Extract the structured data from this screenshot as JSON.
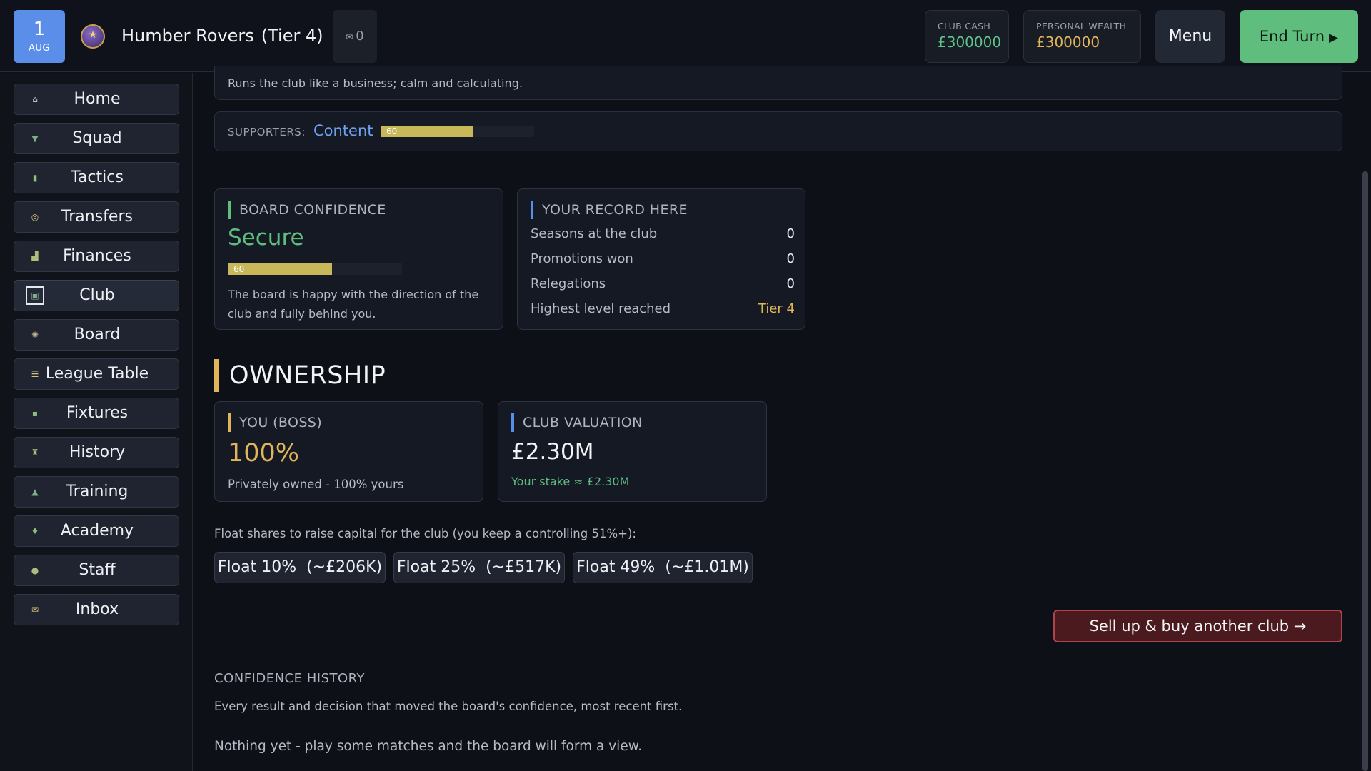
{
  "topbar": {
    "date_day": "1",
    "date_month": "AUG",
    "club_name": "Humber Rovers",
    "club_tier": "(Tier 4)",
    "inbox_count": "0",
    "club_cash_label": "CLUB CASH",
    "club_cash_value": "£300000",
    "personal_wealth_label": "PERSONAL WEALTH",
    "personal_wealth_value": "£300000",
    "menu_label": "Menu",
    "end_turn_label": "End Turn",
    "colors": {
      "accent_blue": "#5b8ee8",
      "accent_green": "#5fbd7e",
      "accent_gold": "#e0b55a"
    }
  },
  "sidebar": {
    "items": [
      {
        "label": "Home",
        "icon": "house-icon"
      },
      {
        "label": "Squad",
        "icon": "shirt-icon"
      },
      {
        "label": "Tactics",
        "icon": "clipboard-icon"
      },
      {
        "label": "Transfers",
        "icon": "swap-icon"
      },
      {
        "label": "Finances",
        "icon": "bar-chart-icon"
      },
      {
        "label": "Club",
        "icon": "stadium-icon"
      },
      {
        "label": "Board",
        "icon": "gear-icon"
      },
      {
        "label": "League Table",
        "icon": "table-icon"
      },
      {
        "label": "Fixtures",
        "icon": "calendar-icon"
      },
      {
        "label": "History",
        "icon": "trophy-icon"
      },
      {
        "label": "Training",
        "icon": "cone-icon"
      },
      {
        "label": "Academy",
        "icon": "graduation-icon"
      },
      {
        "label": "Staff",
        "icon": "person-icon"
      },
      {
        "label": "Inbox",
        "icon": "envelope-icon"
      }
    ],
    "active": "Club"
  },
  "main": {
    "owner_description": "Runs the club like a business; calm and calculating.",
    "supporters": {
      "label": "SUPPORTERS:",
      "mood": "Content",
      "value": "60",
      "level": 60
    },
    "board_confidence": {
      "title": "BOARD CONFIDENCE",
      "status": "Secure",
      "value": "60",
      "level": 60,
      "description": "The board is happy with the direction of the club and fully behind you."
    },
    "record": {
      "title": "YOUR RECORD HERE",
      "rows": [
        {
          "label": "Seasons at the club",
          "value": "0"
        },
        {
          "label": "Promotions won",
          "value": "0"
        },
        {
          "label": "Relegations",
          "value": "0"
        },
        {
          "label": "Highest level reached",
          "value": "Tier 4"
        }
      ]
    },
    "ownership": {
      "section_title": "OWNERSHIP",
      "you_title": "YOU (BOSS)",
      "you_stake": "100%",
      "you_sub": "Privately owned - 100% yours",
      "valuation_title": "CLUB VALUATION",
      "valuation_value": "£2.30M",
      "valuation_sub": "Your stake ≈ £2.30M",
      "float_note": "Float shares to raise capital for the club (you keep a controlling 51%+):",
      "float_options": [
        "Float 10%  (~£206K)",
        "Float 25%  (~£517K)",
        "Float 49%  (~£1.01M)"
      ],
      "sell_label": "Sell up & buy another club →"
    },
    "confidence_history": {
      "title": "CONFIDENCE HISTORY",
      "description": "Every result and decision that moved the board's confidence, most recent first.",
      "empty": "Nothing yet - play some matches and the board will form a view."
    }
  }
}
